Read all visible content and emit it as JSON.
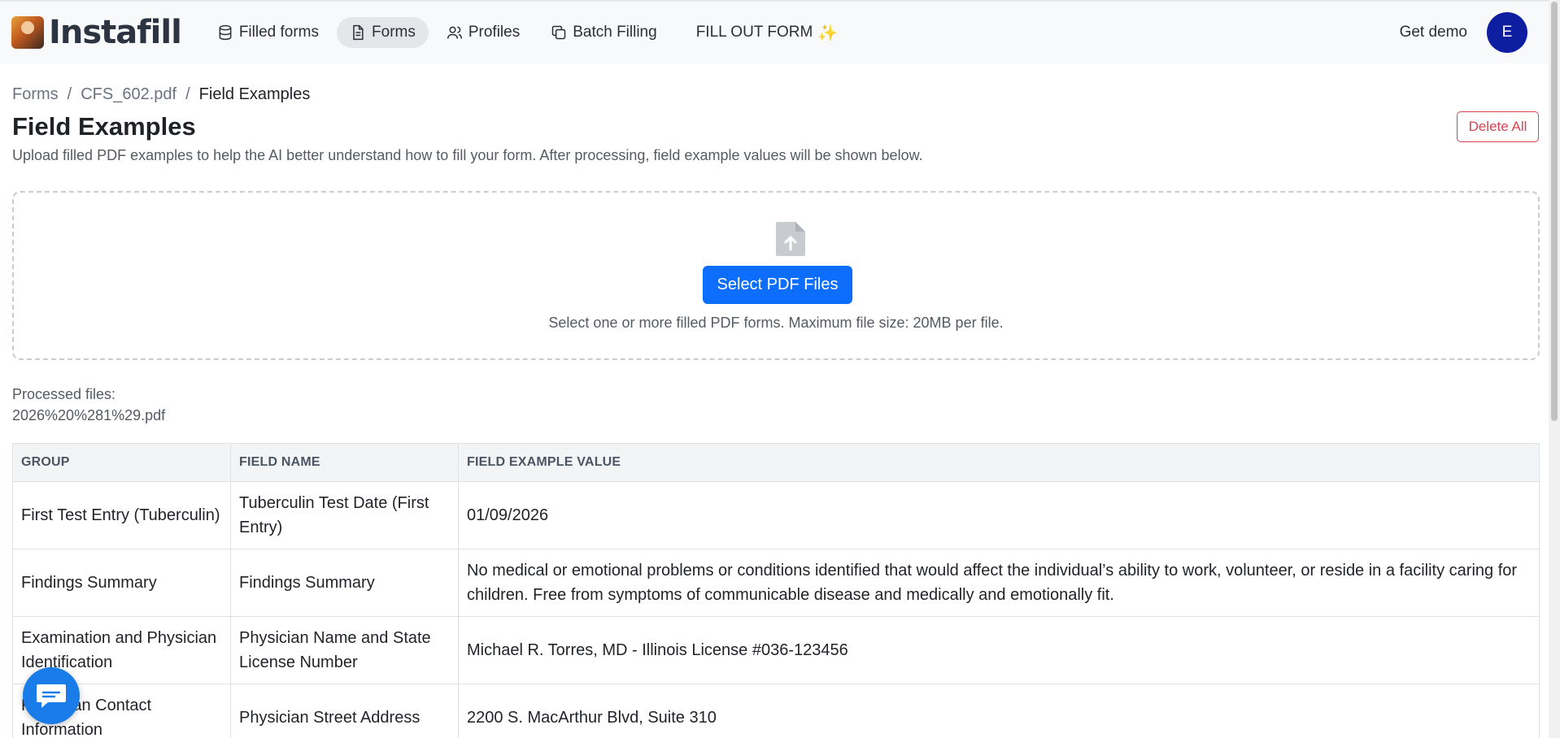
{
  "app": {
    "logo_text": "Instafill"
  },
  "nav": {
    "items": [
      {
        "label": "Filled forms",
        "icon": "database-icon"
      },
      {
        "label": "Forms",
        "icon": "document-icon",
        "active": true
      },
      {
        "label": "Profiles",
        "icon": "users-icon"
      },
      {
        "label": "Batch Filling",
        "icon": "copy-icon"
      }
    ],
    "fill_out_form": "FILL OUT FORM",
    "sparkle": "✨",
    "get_demo": "Get demo",
    "avatar_initial": "E"
  },
  "breadcrumb": {
    "items": [
      "Forms",
      "CFS_602.pdf",
      "Field Examples"
    ],
    "separator": "/"
  },
  "page": {
    "title": "Field Examples",
    "subtitle": "Upload filled PDF examples to help the AI better understand how to fill your form. After processing, field example values will be shown below.",
    "delete_all": "Delete All"
  },
  "upload": {
    "button_label": "Select PDF Files",
    "hint": "Select one or more filled PDF forms. Maximum file size: 20MB per file."
  },
  "processed": {
    "label": "Processed files:",
    "files": [
      "2026%20%281%29.pdf"
    ]
  },
  "table": {
    "headers": [
      "GROUP",
      "FIELD NAME",
      "FIELD EXAMPLE VALUE"
    ],
    "rows": [
      [
        "First Test Entry (Tuberculin)",
        "Tuberculin Test Date (First Entry)",
        "01/09/2026"
      ],
      [
        "Findings Summary",
        "Findings Summary",
        "No medical or emotional problems or conditions identified that would affect the individual’s ability to work, volunteer, or reside in a facility caring for children. Free from symptoms of communicable disease and medically and emotionally fit."
      ],
      [
        "Examination and Physician Identification",
        "Physician Name and State License Number",
        "Michael R. Torres, MD - Illinois License #036-123456"
      ],
      [
        "Physician Contact Information",
        "Physician Street Address",
        "2200 S. MacArthur Blvd, Suite 310"
      ]
    ]
  },
  "colors": {
    "primary": "#0d6efd",
    "danger": "#d9434f",
    "avatar": "#0d1ea0",
    "chat": "#1a7ce8"
  }
}
